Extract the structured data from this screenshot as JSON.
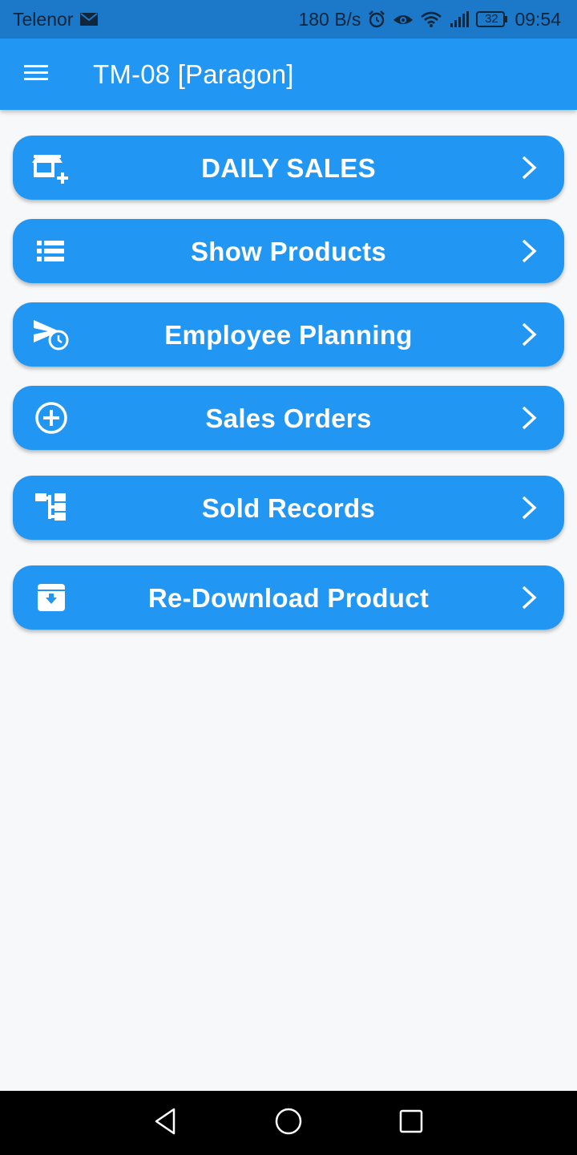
{
  "status_bar": {
    "carrier": "Telenor",
    "net_speed": "180 B/s",
    "battery": "32",
    "time": "09:54"
  },
  "app_bar": {
    "title": "TM-08 [Paragon]",
    "menu_icon": "menu-icon"
  },
  "menu_buttons": [
    {
      "label": "DAILY SALES",
      "icon": "store-add-icon"
    },
    {
      "label": "Show Products",
      "icon": "list-icon"
    },
    {
      "label": "Employee Planning",
      "icon": "send-clock-icon"
    },
    {
      "label": "Sales Orders",
      "icon": "add-circle-icon"
    },
    {
      "label": "Sold Records",
      "icon": "hierarchy-icon"
    },
    {
      "label": "Re-Download Product",
      "icon": "archive-download-icon"
    }
  ],
  "colors": {
    "primary": "#2196F3",
    "status_bar": "#1C78C8",
    "background": "#F7F8F9",
    "nav_bar": "#000000"
  }
}
